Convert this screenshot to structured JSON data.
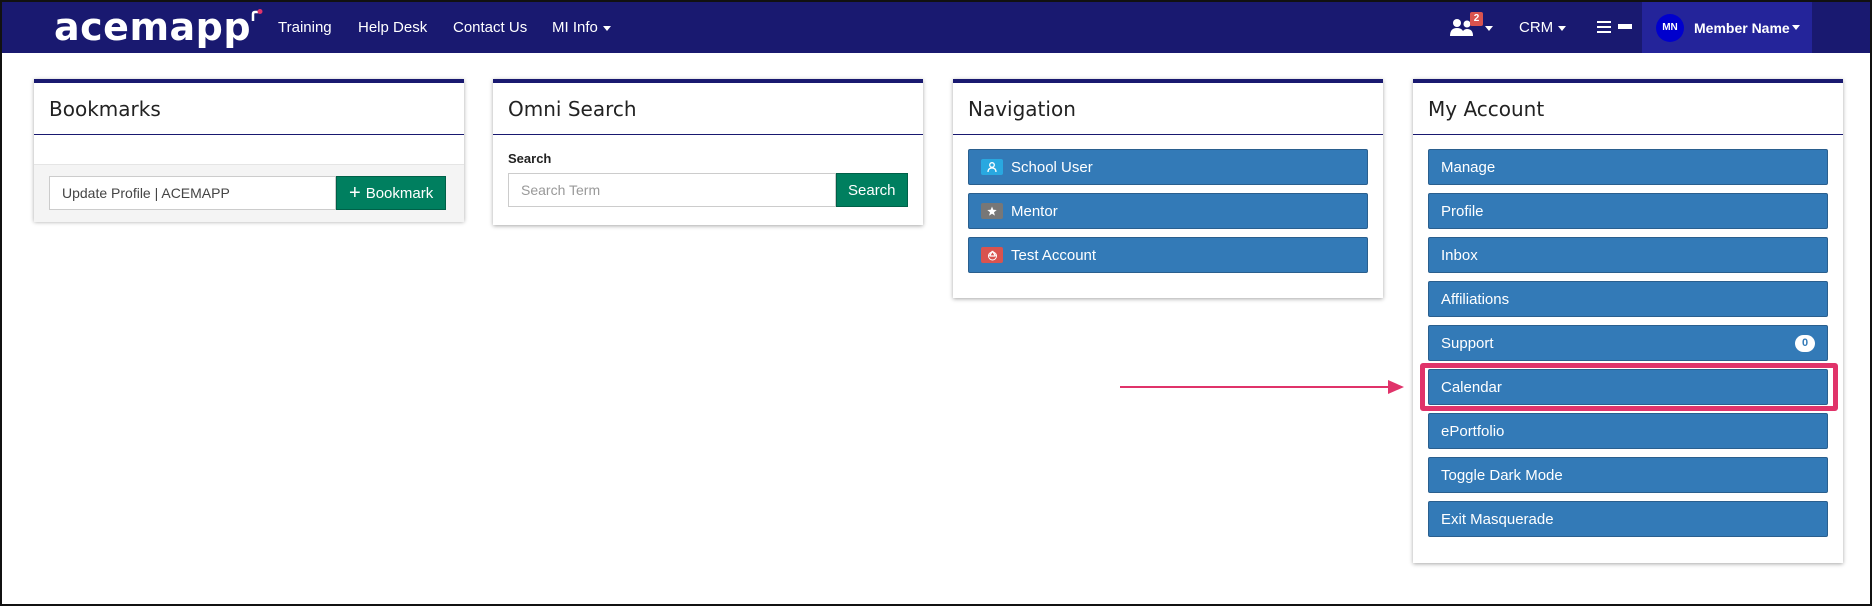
{
  "navbar": {
    "logo": "acemapp",
    "links": [
      "Training",
      "Help Desk",
      "Contact Us",
      "MI Info"
    ],
    "notification_count": "2",
    "crm_label": "CRM",
    "avatar_initials": "MN",
    "member_name": "Member Name"
  },
  "bookmarks": {
    "title": "Bookmarks",
    "input_value": "Update Profile | ACEMAPP",
    "button_label": "Bookmark"
  },
  "omni_search": {
    "title": "Omni Search",
    "label": "Search",
    "placeholder": "Search Term",
    "button_label": "Search"
  },
  "navigation": {
    "title": "Navigation",
    "items": [
      {
        "label": "School User",
        "icon": "user-icon",
        "icon_color": "#29a8e0"
      },
      {
        "label": "Mentor",
        "icon": "mentor-icon",
        "icon_color": "#777777"
      },
      {
        "label": "Test Account",
        "icon": "recycle-icon",
        "icon_color": "#d9534f"
      }
    ]
  },
  "my_account": {
    "title": "My Account",
    "items": [
      {
        "label": "Manage"
      },
      {
        "label": "Profile"
      },
      {
        "label": "Inbox"
      },
      {
        "label": "Affiliations"
      },
      {
        "label": "Support",
        "badge": "0"
      },
      {
        "label": "Calendar"
      },
      {
        "label": "ePortfolio"
      },
      {
        "label": "Toggle Dark Mode"
      },
      {
        "label": "Exit Masquerade"
      }
    ],
    "highlighted_item": "Calendar"
  },
  "colors": {
    "navbar": "#191970",
    "primary_button": "#337ab7",
    "success_button": "#007f5f",
    "highlight": "#e0336a"
  }
}
